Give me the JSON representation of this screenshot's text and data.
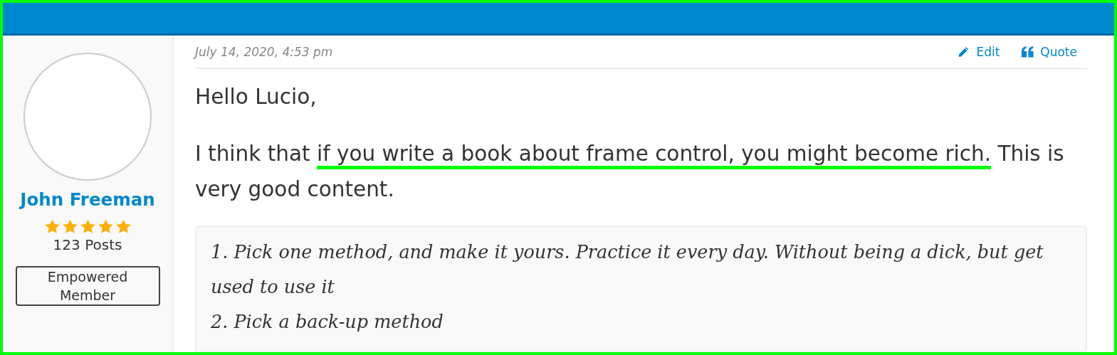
{
  "author": {
    "name": "John Freeman",
    "stars": 5,
    "post_count": "123 Posts",
    "rank": "Empowered Member"
  },
  "post": {
    "date": "July 14, 2020, 4:53 pm",
    "actions": [
      {
        "kind": "edit",
        "label": "Edit"
      },
      {
        "kind": "quote",
        "label": "Quote"
      }
    ],
    "paragraphs": [
      [
        {
          "text": "Hello Lucio,",
          "highlighted": false
        }
      ],
      [
        {
          "text": "I think that ",
          "highlighted": false
        },
        {
          "text": "if you write a book about frame control, you might become rich.",
          "highlighted": true
        },
        {
          "text": " This is very good content.",
          "highlighted": false
        }
      ]
    ],
    "quote_lines": [
      "1. Pick one method, and make it yours. Practice it every day. Without being a dick, but get used to use it",
      "2. Pick a back-up method"
    ]
  }
}
